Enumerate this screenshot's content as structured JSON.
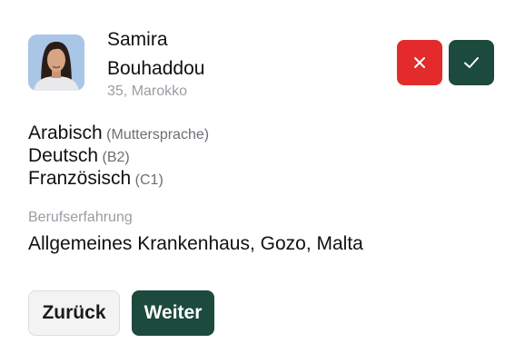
{
  "profile": {
    "first_name": "Samira",
    "last_name": "Bouhaddou",
    "details": "35, Marokko"
  },
  "actions": {
    "reject_icon": "close-icon",
    "accept_icon": "check-icon"
  },
  "languages": [
    {
      "name": "Arabisch",
      "level": "(Muttersprache)"
    },
    {
      "name": "Deutsch",
      "level": "(B2)"
    },
    {
      "name": "Französisch",
      "level": "(C1)"
    }
  ],
  "experience": {
    "label": "Berufserfahrung",
    "value": "Allgemeines Krankenhaus, Gozo, Malta"
  },
  "footer": {
    "back_label": "Zurück",
    "next_label": "Weiter"
  },
  "colors": {
    "reject": "#e32b2b",
    "accent": "#1c4a3d",
    "muted_text": "#9a9da3"
  }
}
